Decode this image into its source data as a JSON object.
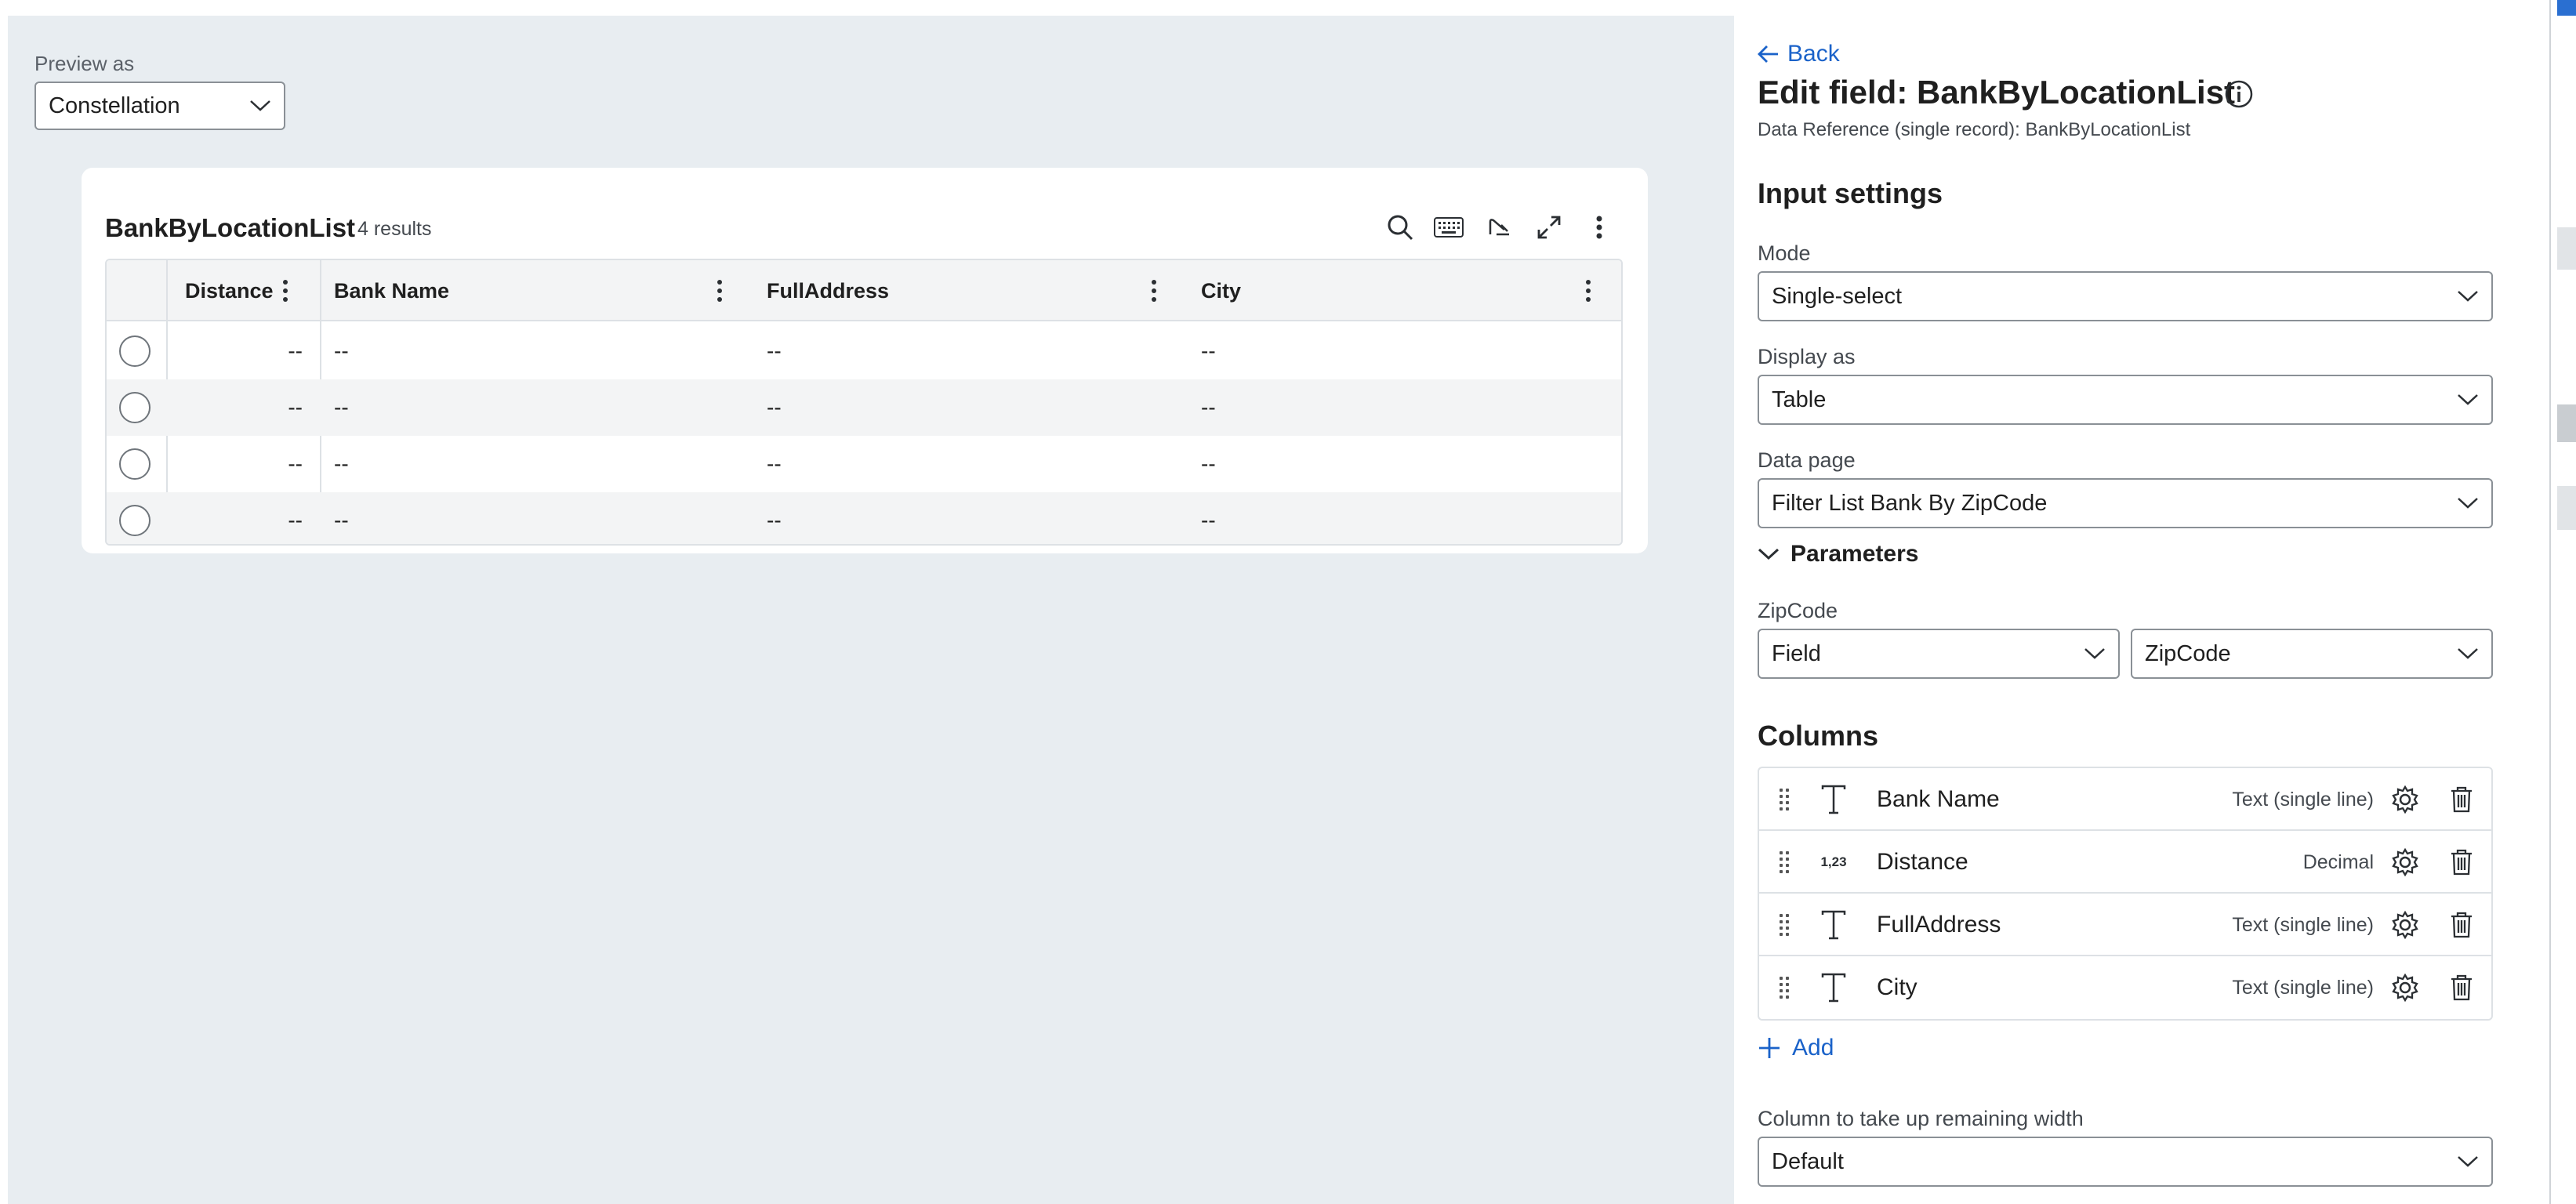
{
  "preview": {
    "label": "Preview as",
    "selected": "Constellation"
  },
  "table_card": {
    "title": "BankByLocationList",
    "count": "4 results",
    "columns": [
      "Distance",
      "Bank Name",
      "FullAddress",
      "City"
    ],
    "rows": [
      [
        "--",
        "--",
        "--",
        "--"
      ],
      [
        "--",
        "--",
        "--",
        "--"
      ],
      [
        "--",
        "--",
        "--",
        "--"
      ],
      [
        "--",
        "--",
        "--",
        "--"
      ]
    ]
  },
  "panel": {
    "back_label": "Back",
    "title": "Edit field: BankByLocationList",
    "subtitle": "Data Reference (single record): BankByLocationList",
    "input_settings_heading": "Input settings",
    "mode": {
      "label": "Mode",
      "value": "Single-select"
    },
    "display_as": {
      "label": "Display as",
      "value": "Table"
    },
    "data_page": {
      "label": "Data page",
      "value": "Filter List Bank By ZipCode"
    },
    "parameters_label": "Parameters",
    "zipcode": {
      "label": "ZipCode",
      "source": "Field",
      "value": "ZipCode"
    },
    "columns_heading": "Columns",
    "columns": [
      {
        "name": "Bank Name",
        "type": "Text (single line)",
        "icon": "text-type-icon",
        "glyph": ""
      },
      {
        "name": "Distance",
        "type": "Decimal",
        "icon": "decimal-type-icon",
        "glyph": "1,23"
      },
      {
        "name": "FullAddress",
        "type": "Text (single line)",
        "icon": "text-type-icon",
        "glyph": ""
      },
      {
        "name": "City",
        "type": "Text (single line)",
        "icon": "text-type-icon",
        "glyph": ""
      }
    ],
    "add_label": "Add",
    "remaining_width": {
      "label": "Column to take up remaining width",
      "value": "Default"
    }
  },
  "colors": {
    "preview_background": "#e8edf1",
    "link": "#1a62c9",
    "border": "#8a9096"
  }
}
